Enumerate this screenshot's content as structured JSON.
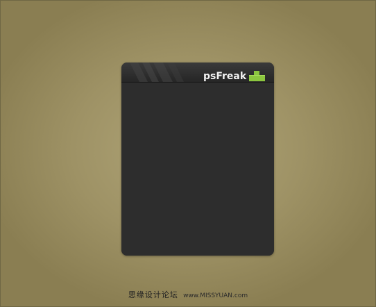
{
  "widget": {
    "brand": "psFreak",
    "icon": "cross-block-logo-icon",
    "colors": {
      "panel": "#2d2d2d",
      "header_top": "#3a3a3a",
      "header_bottom": "#262626",
      "icon_green": "#8cc63f",
      "background": "#a79b6c"
    }
  },
  "footer": {
    "site_name": "思缘设计论坛",
    "site_url": "www.MISSYUAN.com"
  }
}
